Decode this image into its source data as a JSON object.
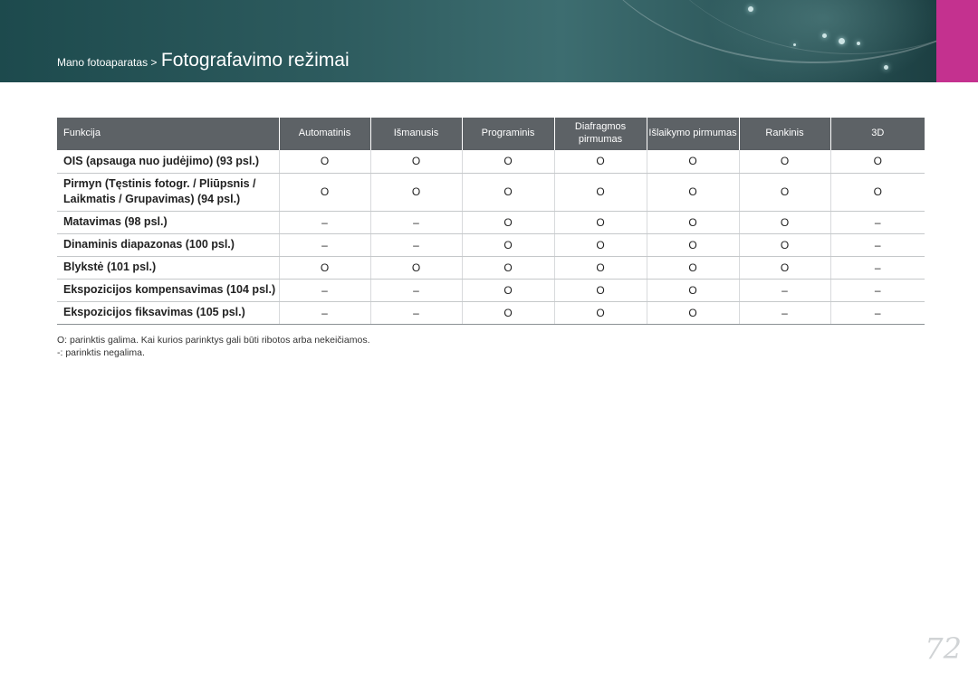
{
  "breadcrumb": {
    "parent": "Mano fotoaparatas >",
    "current": "Fotografavimo režimai"
  },
  "table": {
    "headers": [
      "Funkcija",
      "Automatinis",
      "Išmanusis",
      "Programinis",
      "Diafragmos pirmumas",
      "Išlaikymo pirmumas",
      "Rankinis",
      "3D"
    ],
    "rows": [
      {
        "func": "OIS (apsauga nuo judėjimo) (93 psl.)",
        "cells": [
          "O",
          "O",
          "O",
          "O",
          "O",
          "O",
          "O"
        ]
      },
      {
        "func": "Pirmyn (Tęstinis fotogr. / Pliūpsnis / Laikmatis / Grupavimas) (94 psl.)",
        "cells": [
          "O",
          "O",
          "O",
          "O",
          "O",
          "O",
          "O"
        ]
      },
      {
        "func": "Matavimas (98 psl.)",
        "cells": [
          "–",
          "–",
          "O",
          "O",
          "O",
          "O",
          "–"
        ]
      },
      {
        "func": "Dinaminis diapazonas (100 psl.)",
        "cells": [
          "–",
          "–",
          "O",
          "O",
          "O",
          "O",
          "–"
        ]
      },
      {
        "func": "Blykstė (101 psl.)",
        "cells": [
          "O",
          "O",
          "O",
          "O",
          "O",
          "O",
          "–"
        ]
      },
      {
        "func": "Ekspozicijos kompensavimas (104 psl.)",
        "cells": [
          "–",
          "–",
          "O",
          "O",
          "O",
          "–",
          "–"
        ]
      },
      {
        "func": "Ekspozicijos fiksavimas (105 psl.)",
        "cells": [
          "–",
          "–",
          "O",
          "O",
          "O",
          "–",
          "–"
        ]
      }
    ]
  },
  "notes": {
    "line1": "O: parinktis galima. Kai kurios parinktys gali būti ribotos arba nekeičiamos.",
    "line2": "-: parinktis negalima."
  },
  "page_number": "72",
  "colors": {
    "header_bg": "#2d5b5e",
    "accent_tab": "#c4318f",
    "table_header_bg": "#5d6266"
  }
}
